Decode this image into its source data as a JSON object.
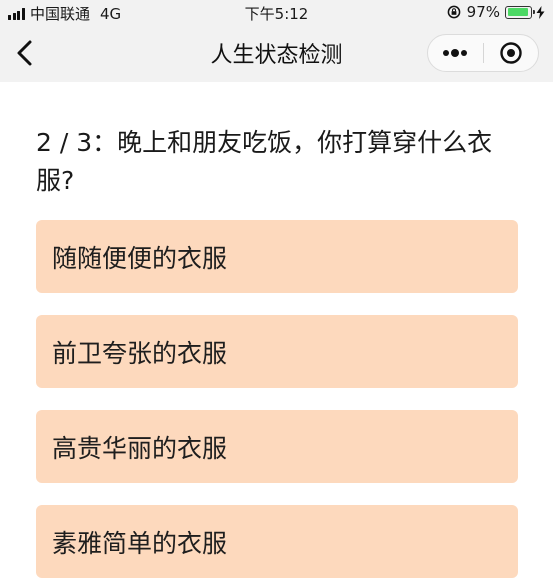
{
  "status_bar": {
    "carrier": "中国联通",
    "network": "4G",
    "time": "下午5:12",
    "battery_percent": "97%",
    "battery_level": 0.97,
    "icons": [
      "signal-icon",
      "rotation-lock-icon",
      "battery-icon",
      "charging-icon"
    ]
  },
  "nav_bar": {
    "title": "人生状态检测",
    "back_icon": "chevron-left-icon",
    "more_icon": "more-dots-icon",
    "close_icon": "capsule-close-icon"
  },
  "question": {
    "text": "2 / 3：晚上和朋友吃饭，你打算穿什么衣服?"
  },
  "options": [
    {
      "label": "随随便便的衣服"
    },
    {
      "label": "前卫夸张的衣服"
    },
    {
      "label": "高贵华丽的衣服"
    },
    {
      "label": "素雅简单的衣服"
    }
  ],
  "colors": {
    "option_background": "#fdd9bd",
    "bar_background": "#f2f2f2",
    "battery_green": "#4cd964"
  }
}
